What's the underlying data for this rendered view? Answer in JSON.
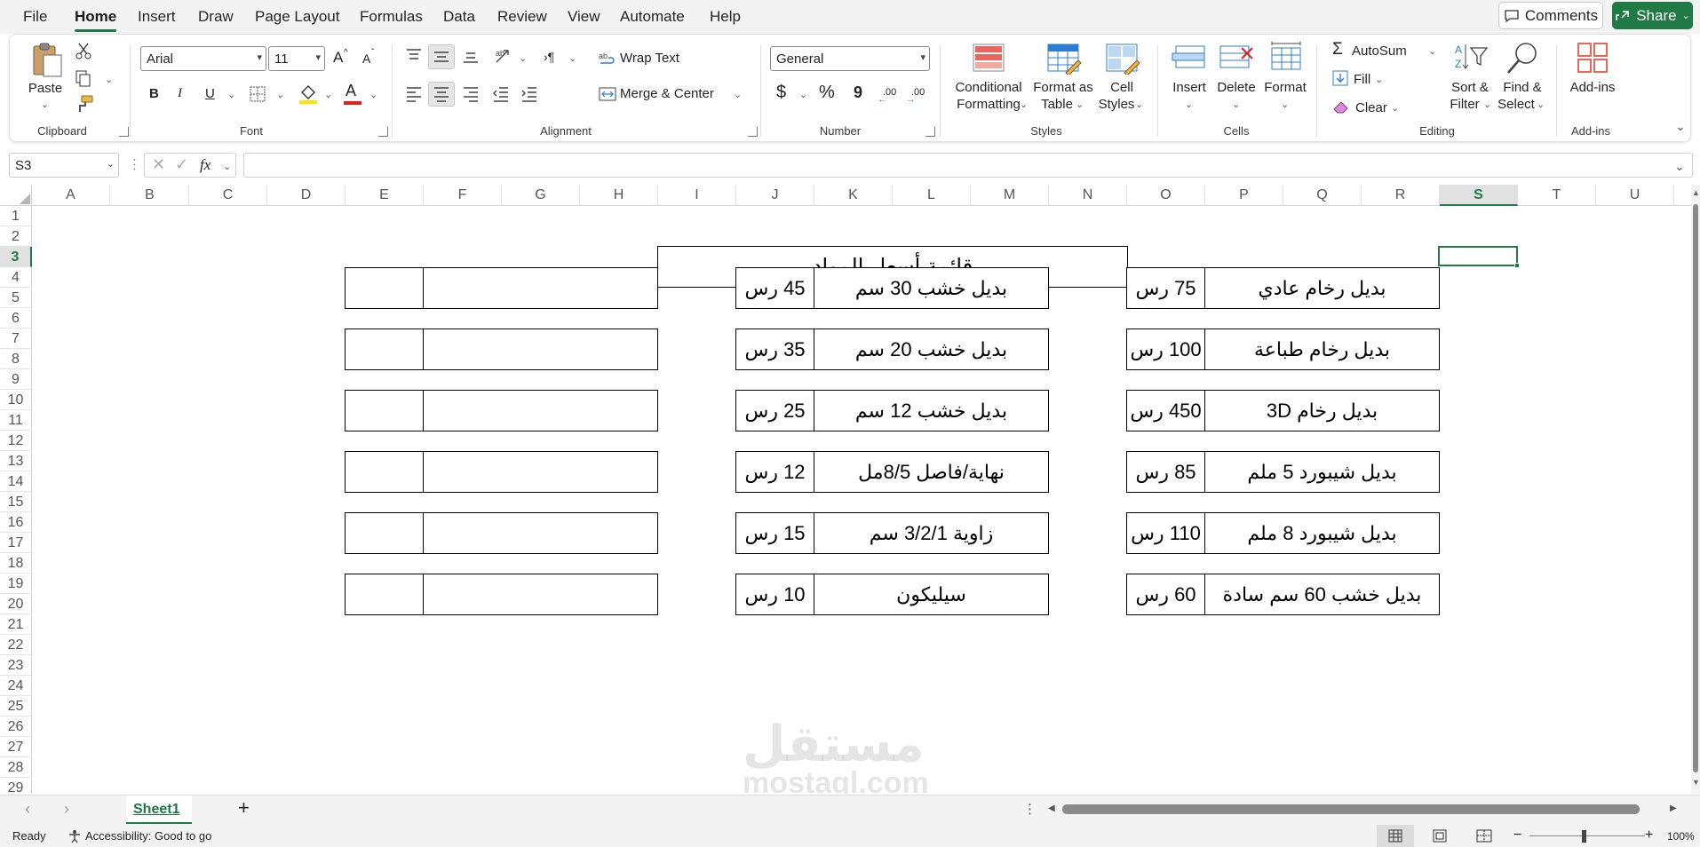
{
  "menu": {
    "tabs": [
      "File",
      "Home",
      "Insert",
      "Draw",
      "Page Layout",
      "Formulas",
      "Data",
      "Review",
      "View",
      "Automate",
      "Help"
    ],
    "active_tab": "Home",
    "comments_label": "Comments",
    "share_label": "Share"
  },
  "ribbon": {
    "clipboard": {
      "paste_label": "Paste",
      "group_label": "Clipboard"
    },
    "font": {
      "font_name": "Arial",
      "font_size": "11",
      "bold": "B",
      "italic": "I",
      "underline": "U",
      "font_color_glyph": "A",
      "grow_glyph": "A",
      "shrink_glyph": "A",
      "group_label": "Font"
    },
    "alignment": {
      "wrap_text_label": "Wrap Text",
      "merge_center_label": "Merge & Center",
      "group_label": "Alignment"
    },
    "number": {
      "format": "General",
      "currency": "$",
      "percent": "%",
      "comma": "9",
      "inc_decimal": ".00",
      "dec_decimal": ".00",
      "group_label": "Number"
    },
    "styles": {
      "conditional_formatting_line1": "Conditional",
      "conditional_formatting_line2": "Formatting",
      "format_as_table_line1": "Format as",
      "format_as_table_line2": "Table",
      "cell_styles_line1": "Cell",
      "cell_styles_line2": "Styles",
      "group_label": "Styles"
    },
    "cells": {
      "insert_label": "Insert",
      "delete_label": "Delete",
      "format_label": "Format",
      "group_label": "Cells"
    },
    "editing": {
      "autosum_label": "AutoSum",
      "fill_label": "Fill",
      "clear_label": "Clear",
      "sort_filter_line1": "Sort &",
      "sort_filter_line2": "Filter",
      "find_select_line1": "Find &",
      "find_select_line2": "Select",
      "group_label": "Editing"
    },
    "addins": {
      "addins_label": "Add-ins",
      "group_label": "Add-ins"
    }
  },
  "formula_bar": {
    "name_box": "S3",
    "fx": "fx",
    "formula": ""
  },
  "grid": {
    "columns": [
      "A",
      "B",
      "C",
      "D",
      "E",
      "F",
      "G",
      "H",
      "I",
      "J",
      "K",
      "L",
      "M",
      "N",
      "O",
      "P",
      "Q",
      "R",
      "S",
      "T",
      "U"
    ],
    "rows": [
      "1",
      "2",
      "3",
      "4",
      "5",
      "6",
      "7",
      "8",
      "9",
      "10",
      "11",
      "12",
      "13",
      "14",
      "15",
      "16",
      "17",
      "18",
      "19",
      "20",
      "21",
      "22",
      "23",
      "24",
      "25",
      "26",
      "27",
      "28",
      "29"
    ],
    "selected_column": "S",
    "selected_row": "3"
  },
  "sheet": {
    "title": "قائمة أسعار المواد",
    "right_table": [
      {
        "item": "بديل رخام عادي",
        "price": "75 رس"
      },
      {
        "item": "بديل رخام طباعة",
        "price": "100 رس"
      },
      {
        "item": "بديل رخام 3D",
        "price": "450 رس"
      },
      {
        "item": "بديل شيبورد 5 ملم",
        "price": "85 رس"
      },
      {
        "item": "بديل شيبورد 8 ملم",
        "price": "110 رس"
      },
      {
        "item": "بديل خشب 60 سم سادة",
        "price": "60 رس"
      }
    ],
    "middle_table": [
      {
        "item": "بديل خشب 30 سم",
        "price": "45 رس"
      },
      {
        "item": "بديل خشب 20 سم",
        "price": "35 رس"
      },
      {
        "item": "بديل خشب 12 سم",
        "price": "25 رس"
      },
      {
        "item": "نهاية/فاصل 8/5مل",
        "price": "12 رس"
      },
      {
        "item": "زاوية 3/2/1 سم",
        "price": "15 رس"
      },
      {
        "item": "سيليكون",
        "price": "10 رس"
      }
    ],
    "left_table": [
      {
        "item": "",
        "price": ""
      },
      {
        "item": "",
        "price": ""
      },
      {
        "item": "",
        "price": ""
      },
      {
        "item": "",
        "price": ""
      },
      {
        "item": "",
        "price": ""
      },
      {
        "item": "",
        "price": ""
      }
    ]
  },
  "watermark": {
    "arabic": "مستقل",
    "latin": "mostaql.com"
  },
  "sheet_tabs": {
    "tabs": [
      "Sheet1"
    ],
    "add_glyph": "+"
  },
  "status": {
    "ready": "Ready",
    "accessibility": "Accessibility: Good to go",
    "zoom": "100%"
  },
  "colors": {
    "accent": "#1f7a45",
    "grid_line": "#e0e0e0"
  }
}
